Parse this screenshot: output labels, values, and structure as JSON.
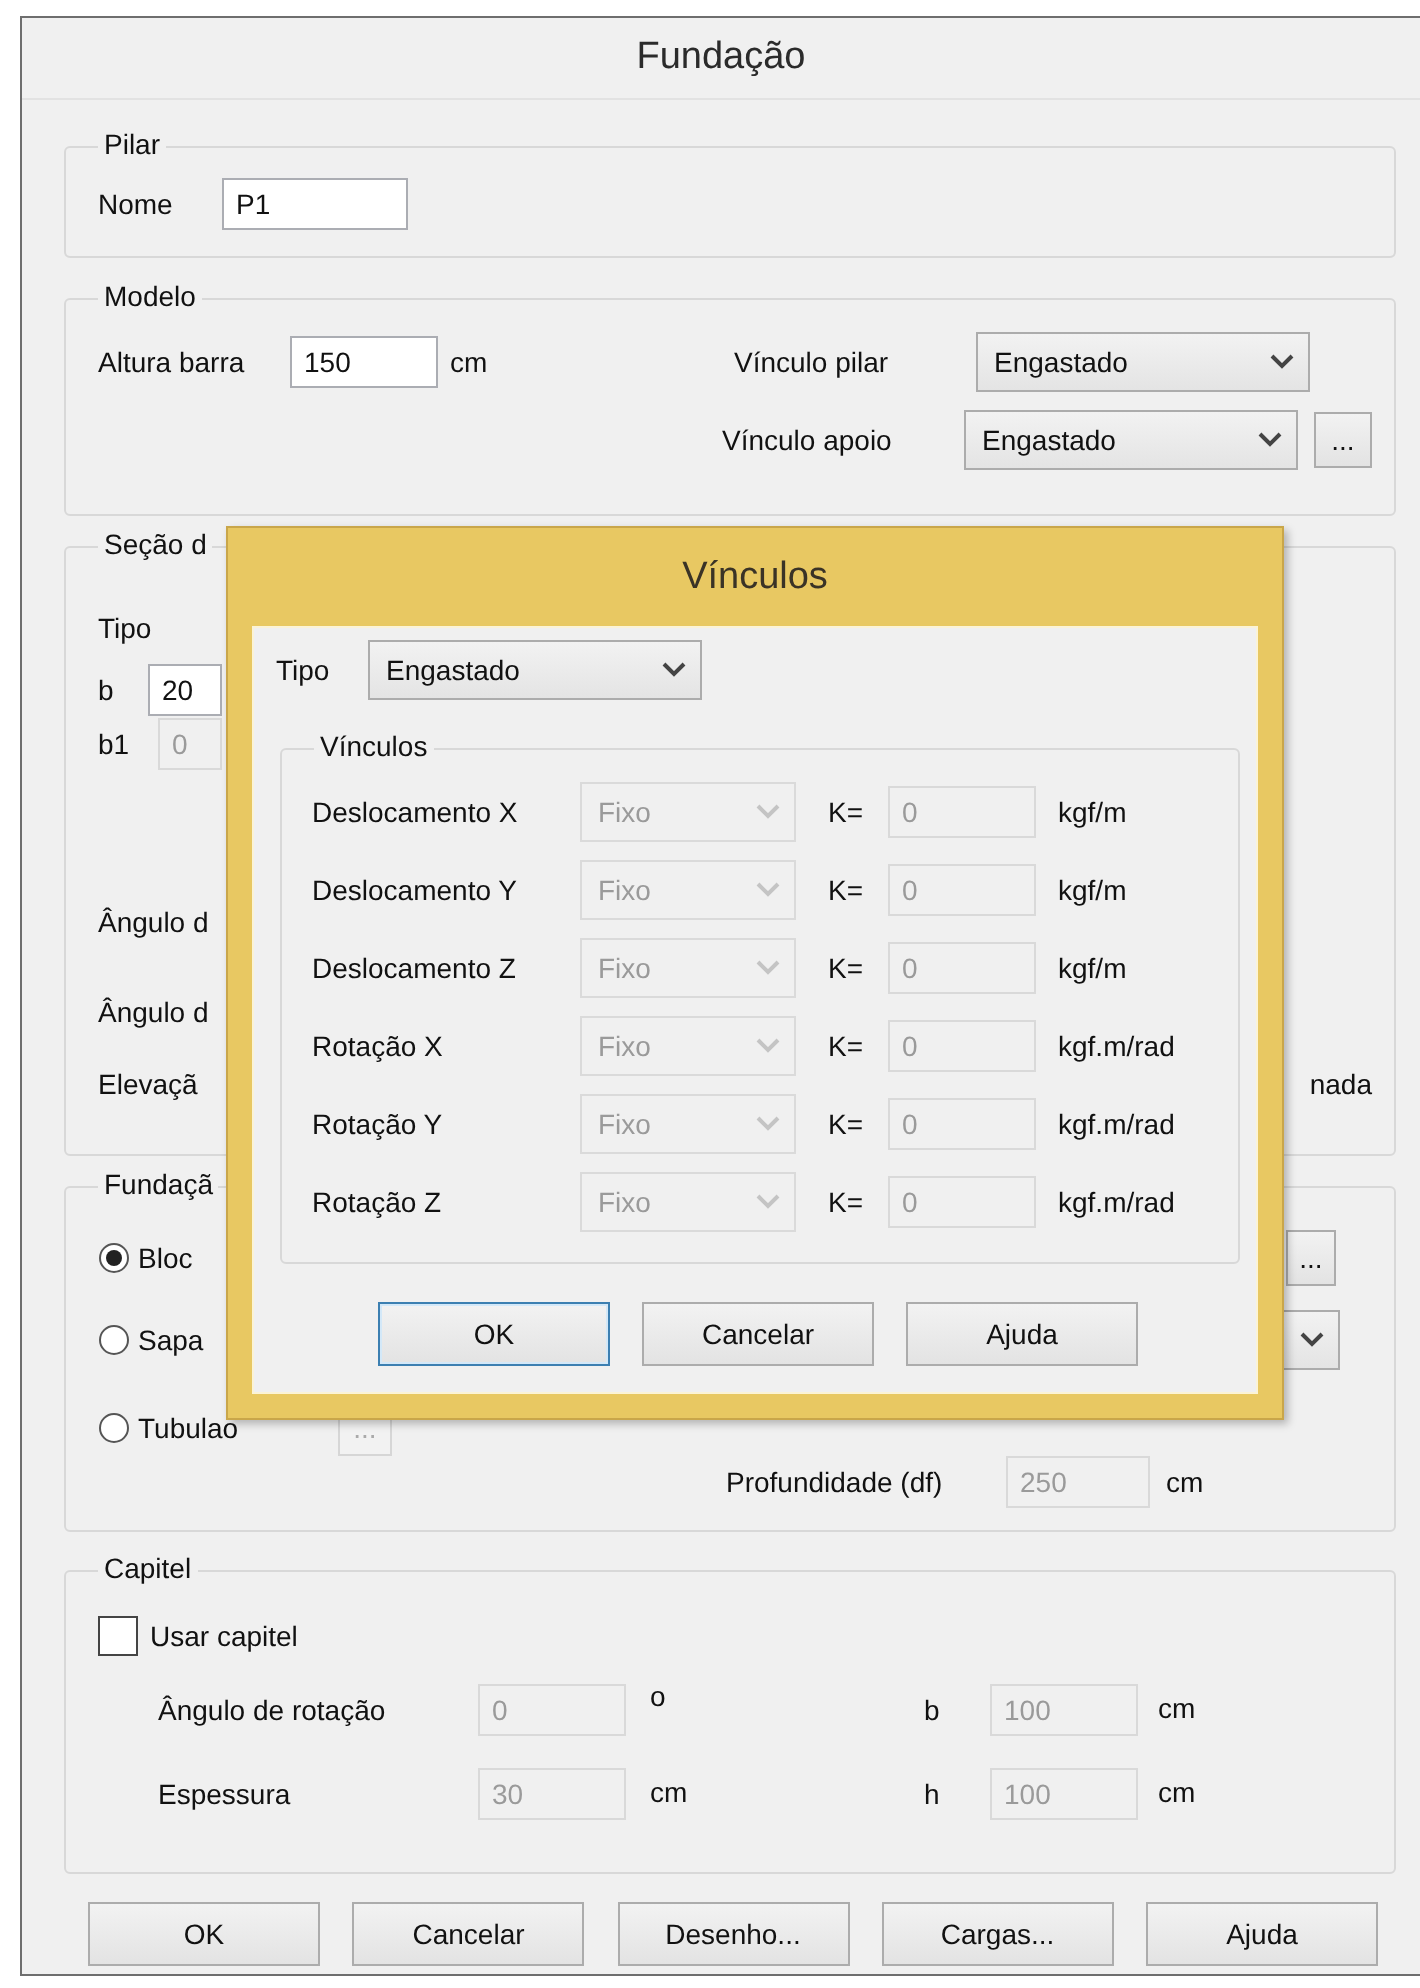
{
  "window": {
    "title": "Fundação"
  },
  "pilar": {
    "legend": "Pilar",
    "nome": {
      "label": "Nome",
      "value": "P1",
      "disabled": false
    }
  },
  "modelo": {
    "legend": "Modelo",
    "altura": {
      "label": "Altura barra",
      "value": "150",
      "unit": "cm",
      "disabled": false
    },
    "vinculo_pilar": {
      "label": "Vínculo pilar",
      "value": "Engastado"
    },
    "vinculo_apoio": {
      "label": "Vínculo apoio",
      "value": "Engastado",
      "button": "..."
    }
  },
  "secao": {
    "legend": "Seção d",
    "tipo_label": "Tipo",
    "b": {
      "label": "b",
      "value": "20",
      "disabled": false
    },
    "b1": {
      "label": "b1",
      "value": "0",
      "disabled": true
    },
    "labels": [
      "Ângulo d",
      "Ângulo d",
      "Elevaçã"
    ],
    "right_text": "nada"
  },
  "fundacao": {
    "legend": "Fundaçã",
    "options": [
      {
        "label": "Bloc",
        "selected": true
      },
      {
        "label": "Sapa",
        "selected": false
      },
      {
        "label": "Tubulao",
        "selected": false
      }
    ],
    "bloco_button": "...",
    "tubulao_button": {
      "label": "...",
      "disabled": true
    },
    "profundidade": {
      "label": "Profundidade (df)",
      "value": "250",
      "unit": "cm",
      "disabled": true
    }
  },
  "capitel": {
    "legend": "Capitel",
    "usar": {
      "label": "Usar capitel",
      "checked": false
    },
    "fields": [
      {
        "label": "Ângulo de rotação",
        "value": "0",
        "unit": "o",
        "disabled": true
      },
      {
        "label": "b",
        "value": "100",
        "unit": "cm",
        "disabled": true
      },
      {
        "label": "Espessura",
        "value": "30",
        "unit": "cm",
        "disabled": true
      },
      {
        "label": "h",
        "value": "100",
        "unit": "cm",
        "disabled": true
      }
    ]
  },
  "buttons": [
    "OK",
    "Cancelar",
    "Desenho...",
    "Cargas...",
    "Ajuda"
  ],
  "dialog": {
    "title": "Vínculos",
    "tipo": {
      "label": "Tipo",
      "value": "Engastado"
    },
    "legend": "Vínculos",
    "rows": [
      {
        "label": "Deslocamento X",
        "value": "Fixo",
        "k_label": "K=",
        "k_value": "0",
        "unit": "kgf/m",
        "disabled": true
      },
      {
        "label": "Deslocamento Y",
        "value": "Fixo",
        "k_label": "K=",
        "k_value": "0",
        "unit": "kgf/m",
        "disabled": true
      },
      {
        "label": "Deslocamento Z",
        "value": "Fixo",
        "k_label": "K=",
        "k_value": "0",
        "unit": "kgf/m",
        "disabled": true
      },
      {
        "label": "Rotação X",
        "value": "Fixo",
        "k_label": "K=",
        "k_value": "0",
        "unit": "kgf.m/rad",
        "disabled": true
      },
      {
        "label": "Rotação Y",
        "value": "Fixo",
        "k_label": "K=",
        "k_value": "0",
        "unit": "kgf.m/rad",
        "disabled": true
      },
      {
        "label": "Rotação Z",
        "value": "Fixo",
        "k_label": "K=",
        "k_value": "0",
        "unit": "kgf.m/rad",
        "disabled": true
      }
    ],
    "buttons": [
      {
        "label": "OK",
        "focused": true
      },
      {
        "label": "Cancelar",
        "focused": false
      },
      {
        "label": "Ajuda",
        "focused": false
      }
    ]
  }
}
